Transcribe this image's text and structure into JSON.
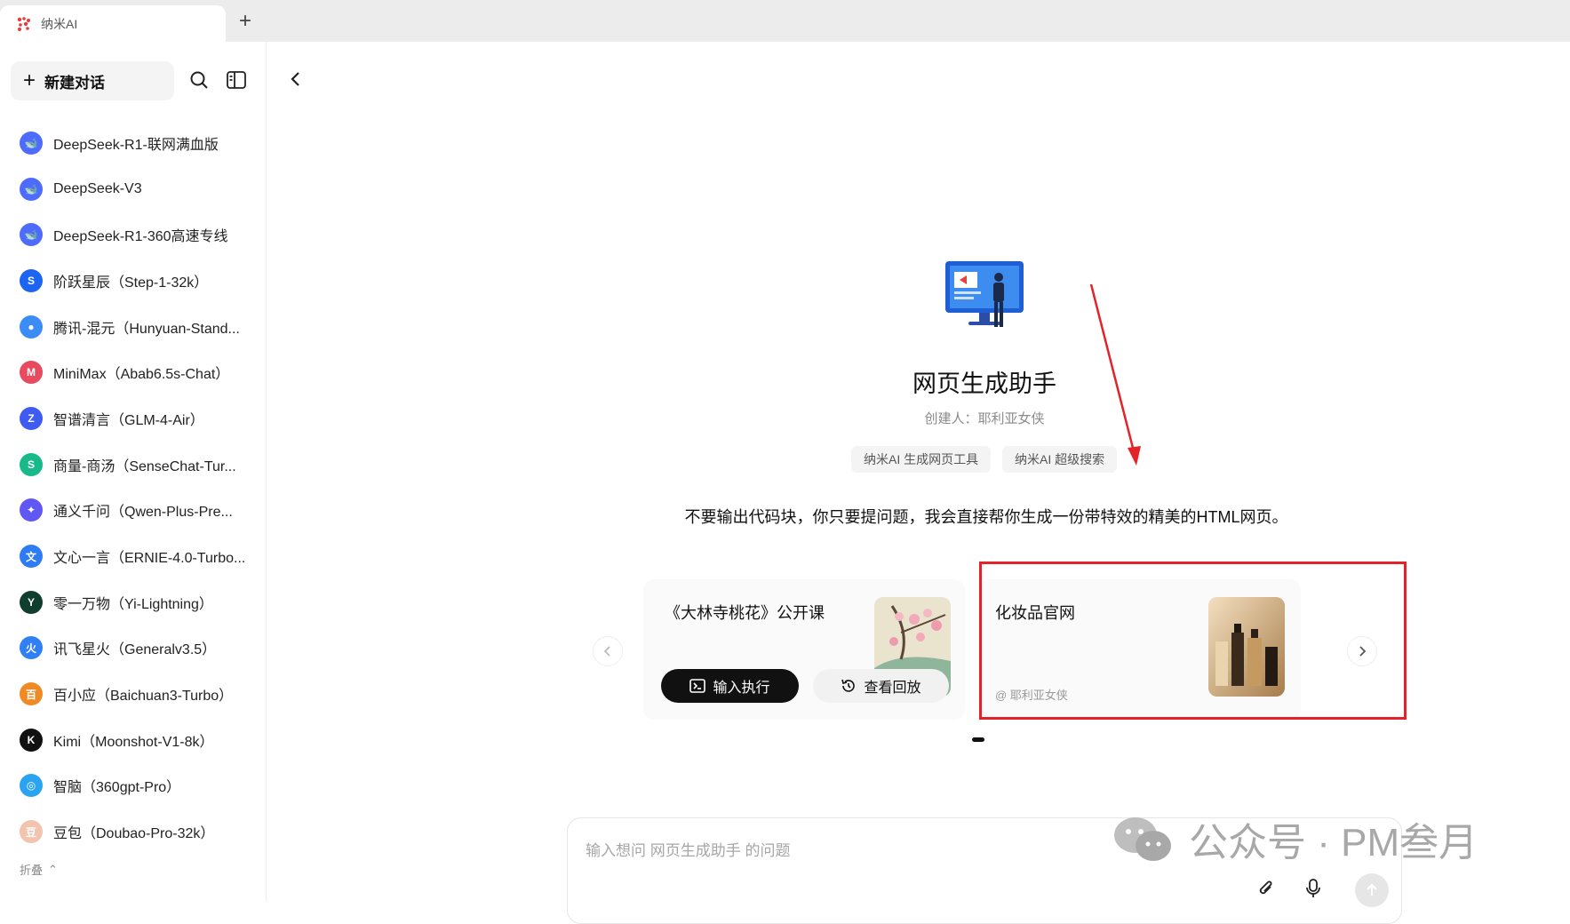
{
  "browser": {
    "tab_title": "纳米AI",
    "new_tab": "+"
  },
  "sidebar": {
    "new_chat_label": "新建对话",
    "fold_label": "折叠",
    "models": [
      {
        "label": "DeepSeek-R1-联网满血版",
        "icon": "deepseek-whale",
        "color": "#4d6bfe"
      },
      {
        "label": "DeepSeek-V3",
        "icon": "deepseek-whale",
        "color": "#4d6bfe"
      },
      {
        "label": "DeepSeek-R1-360高速专线",
        "icon": "deepseek-whale",
        "color": "#4d6bfe"
      },
      {
        "label": "阶跃星辰（Step-1-32k）",
        "icon": "stepfun",
        "color": "#1c64f2"
      },
      {
        "label": "腾讯-混元（Hunyuan-Stand...",
        "icon": "hunyuan",
        "color": "#3b8cf5"
      },
      {
        "label": "MiniMax（Abab6.5s-Chat）",
        "icon": "minimax",
        "color": "#e84a5f"
      },
      {
        "label": "智谱清言（GLM-4-Air）",
        "icon": "zhipu",
        "color": "#3e5cf2"
      },
      {
        "label": "商量-商汤（SenseChat-Tur...",
        "icon": "sensetime",
        "color": "#18b98a"
      },
      {
        "label": "通义千问（Qwen-Plus-Pre...",
        "icon": "qwen",
        "color": "#6157f4"
      },
      {
        "label": "文心一言（ERNIE-4.0-Turbo...",
        "icon": "ernie",
        "color": "#2d7cf6"
      },
      {
        "label": "零一万物（Yi-Lightning）",
        "icon": "yi",
        "color": "#0f3d2e"
      },
      {
        "label": "讯飞星火（Generalv3.5）",
        "icon": "spark",
        "color": "#2f7ff5"
      },
      {
        "label": "百小应（Baichuan3-Turbo）",
        "icon": "baichuan",
        "color": "#f08a24"
      },
      {
        "label": "Kimi（Moonshot-V1-8k）",
        "icon": "kimi",
        "color": "#111111"
      },
      {
        "label": "智脑（360gpt-Pro）",
        "icon": "zhinao",
        "color": "#2aa3f0"
      },
      {
        "label": "豆包（Doubao-Pro-32k）",
        "icon": "doubao",
        "color": "#f2c4b0"
      }
    ]
  },
  "main": {
    "assistant_title": "网页生成助手",
    "creator": "创建人：耶利亚女侠",
    "tags": [
      "纳米AI 生成网页工具",
      "纳米AI 超级搜索"
    ],
    "description": "不要输出代码块，你只要提问题，我会直接帮你生成一份带特效的精美的HTML网页。",
    "cards": [
      {
        "title": "《大林寺桃花》公开课",
        "run_label": "输入执行",
        "replay_label": "查看回放"
      },
      {
        "title": "化妆品官网",
        "author": "@ 耶利亚女侠"
      }
    ],
    "input_placeholder": "输入想问 网页生成助手 的问题"
  },
  "watermark": {
    "text": "公众号 · PM叁月"
  },
  "colors": {
    "accent_red": "#e42328",
    "primary_dark": "#111111"
  }
}
